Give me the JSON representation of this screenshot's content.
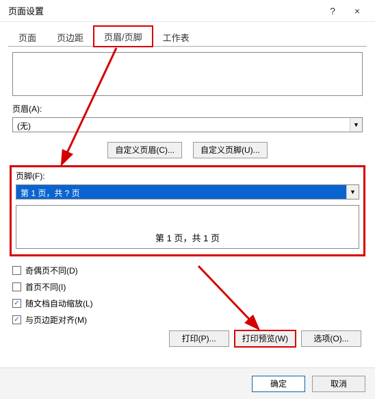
{
  "window": {
    "title": "页面设置",
    "help_tip": "?",
    "close_tip": "×"
  },
  "tabs": {
    "items": [
      {
        "label": "页面"
      },
      {
        "label": "页边距"
      },
      {
        "label": "页眉/页脚"
      },
      {
        "label": "工作表"
      }
    ],
    "active_index": 2
  },
  "header": {
    "label": "页眉(A):",
    "value": "(无)"
  },
  "custom_buttons": {
    "header": "自定义页眉(C)...",
    "footer": "自定义页脚(U)..."
  },
  "footer": {
    "label": "页脚(F):",
    "value": "第 1 页，共 ? 页",
    "preview": "第 1 页，共 1 页"
  },
  "checks": {
    "odd_even": {
      "label": "奇偶页不同(D)",
      "checked": false
    },
    "first_page": {
      "label": "首页不同(I)",
      "checked": false
    },
    "scale_doc": {
      "label": "随文档自动缩放(L)",
      "checked": true
    },
    "align_margin": {
      "label": "与页边距对齐(M)",
      "checked": true
    }
  },
  "action_buttons": {
    "print": "打印(P)...",
    "preview": "打印预览(W)",
    "options": "选项(O)..."
  },
  "bottom": {
    "ok": "确定",
    "cancel": "取消"
  }
}
